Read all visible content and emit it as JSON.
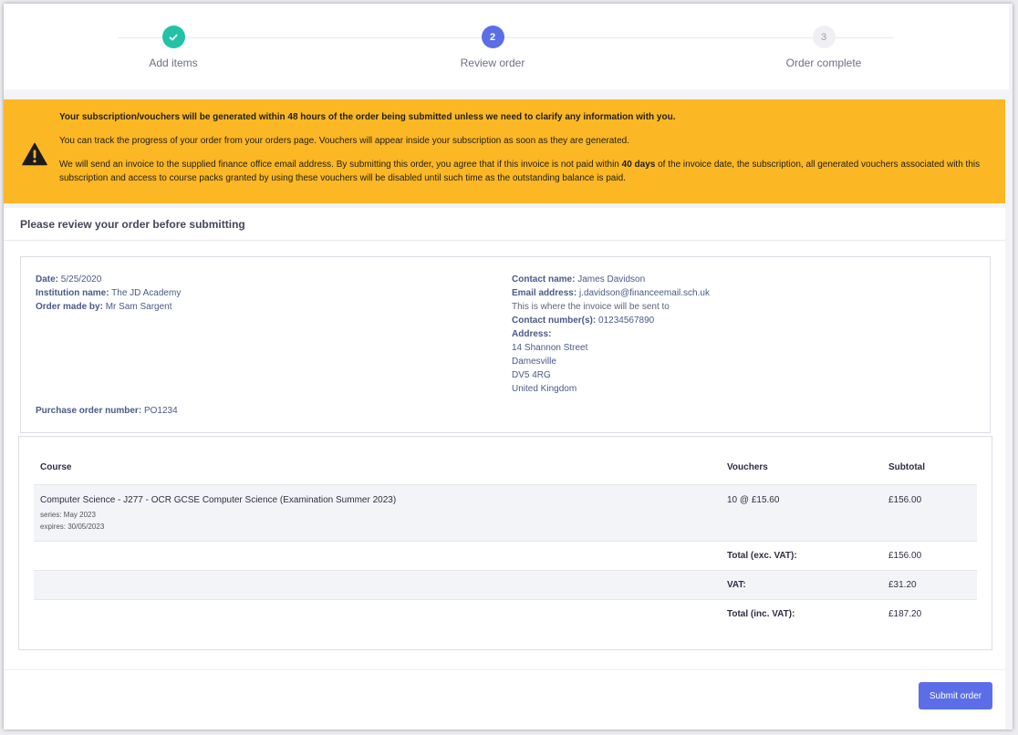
{
  "stepper": {
    "steps": [
      {
        "label": "Add items",
        "marker": "check-icon",
        "state": "done"
      },
      {
        "label": "Review order",
        "number": "2",
        "state": "active"
      },
      {
        "label": "Order complete",
        "number": "3",
        "state": "todo"
      }
    ]
  },
  "warning": {
    "icon": "warning-icon",
    "lead": "Your subscription/vouchers will be generated within 48 hours of the order being submitted unless we need to clarify any information with you.",
    "track": "You can track the progress of your order from your orders page. Vouchers will appear inside your subscription as soon as they are generated.",
    "invoice_before": "We will send an invoice to the supplied finance office email address. By submitting this order, you agree that if this invoice is not paid within ",
    "invoice_bold": "40 days",
    "invoice_after": " of the invoice date, the subscription, all generated vouchers associated with this subscription and access to course packs granted by using these vouchers will be disabled until such time as the outstanding balance is paid."
  },
  "review": {
    "title": "Please review your order before submitting",
    "date_label": "Date:",
    "date": "5/25/2020",
    "institution_label": "Institution name:",
    "institution": "The JD Academy",
    "made_by_label": "Order made by:",
    "made_by": "Mr Sam Sargent",
    "po_label": "Purchase order number:",
    "po": "PO1234",
    "contact_label": "Contact name:",
    "contact": "James Davidson",
    "email_label": "Email address:",
    "email": "j.davidson@financeemail.sch.uk",
    "email_note": "This is where the invoice will be sent to",
    "phone_label": "Contact number(s):",
    "phone": "01234567890",
    "address_label": "Address:",
    "address": [
      "14 Shannon Street",
      "Damesville",
      "DV5 4RG",
      "United Kingdom"
    ]
  },
  "table": {
    "headers": {
      "course": "Course",
      "vouchers": "Vouchers",
      "subtotal": "Subtotal"
    },
    "items": [
      {
        "course": "Computer Science - J277 - OCR GCSE Computer Science (Examination Summer 2023)",
        "series": "series: May 2023",
        "expires": "expires: 30/05/2023",
        "vouchers": "10 @ £15.60",
        "subtotal": "£156.00"
      }
    ],
    "totals": [
      {
        "label": "Total (exc. VAT):",
        "value": "£156.00"
      },
      {
        "label": "VAT:",
        "value": "£31.20"
      },
      {
        "label": "Total (inc. VAT):",
        "value": "£187.20"
      }
    ]
  },
  "actions": {
    "submit_label": "Submit order"
  }
}
